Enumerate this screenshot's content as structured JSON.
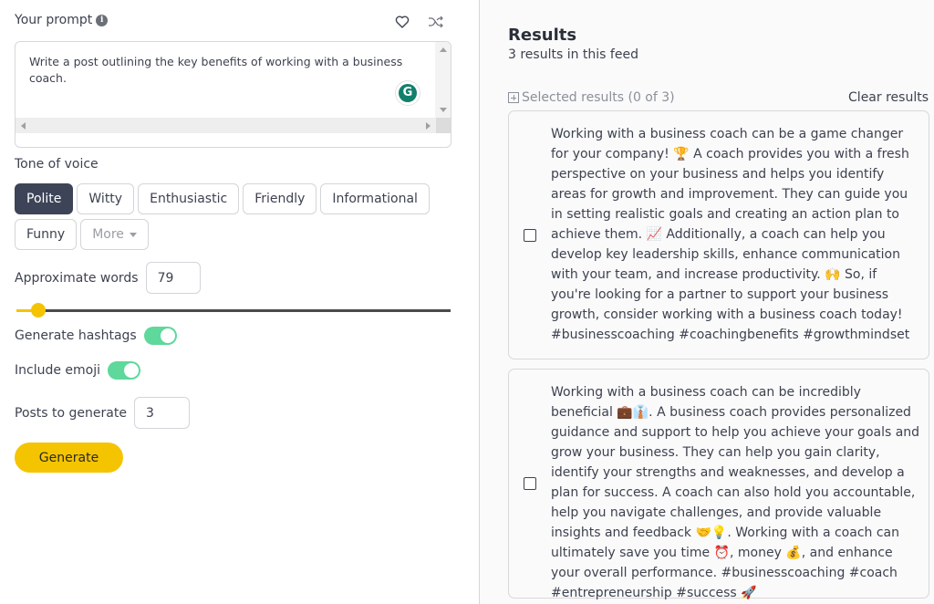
{
  "prompt": {
    "label": "Your prompt",
    "info_icon": "info-icon",
    "favorite_icon": "heart-icon",
    "shuffle_icon": "shuffle-icon",
    "value": "Write a post outlining the key benefits of working with a business coach.",
    "grammarly_glyph": "G"
  },
  "tone": {
    "label": "Tone of voice",
    "options": [
      "Polite",
      "Witty",
      "Enthusiastic",
      "Friendly",
      "Informational",
      "Funny"
    ],
    "selected": "Polite",
    "more_label": "More"
  },
  "words": {
    "label": "Approximate words",
    "value": "79",
    "slider_fraction": 0.05
  },
  "hashtags": {
    "label": "Generate hashtags",
    "enabled": true
  },
  "emoji": {
    "label": "Include emoji",
    "enabled": true
  },
  "posts": {
    "label": "Posts to generate",
    "value": "3"
  },
  "generate_label": "Generate",
  "results": {
    "title": "Results",
    "count_text": "3 results in this feed",
    "selected_text": "Selected results (0 of 3)",
    "clear_label": "Clear results",
    "items": [
      {
        "text": "Working with a business coach can be a game changer for your company! 🏆 A coach provides you with a fresh perspective on your business and helps you identify areas for growth and improvement. They can guide you in setting realistic goals and creating an action plan to achieve them. 📈 Additionally, a coach can help you develop key leadership skills, enhance communication with your team, and increase productivity. 🙌 So, if you're looking for a partner to support your business growth, consider working with a business coach today! #businesscoaching #coachingbenefits #growthmindset",
        "checked": false
      },
      {
        "text": "Working with a business coach can be incredibly beneficial 💼👔. A business coach provides personalized guidance and support to help you achieve your goals and grow your business. They can help you gain clarity, identify your strengths and weaknesses, and develop a plan for success. A coach can also hold you accountable, help you navigate challenges, and provide valuable insights and feedback 🤝💡. Working with a coach can ultimately save you time ⏰, money 💰, and enhance your overall performance. #businesscoaching #coach #entrepreneurship #success 🚀",
        "checked": false
      }
    ]
  },
  "colors": {
    "accent_yellow": "#f5c400",
    "toggle_green": "#5ed89b",
    "selected_chip": "#3d4458",
    "grammarly_green": "#11806a"
  }
}
